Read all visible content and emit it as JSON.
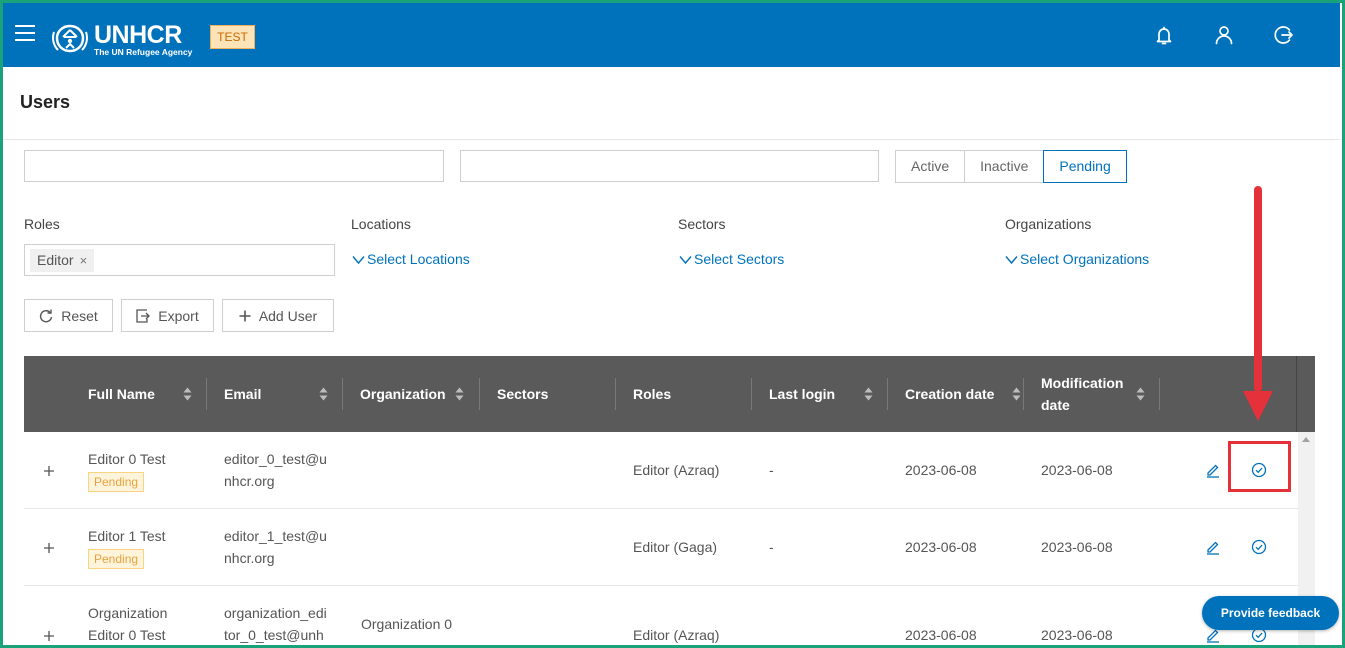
{
  "header": {
    "logo_name": "UNHCR",
    "logo_subtitle": "The UN Refugee Agency",
    "env_badge": "TEST",
    "icons": [
      "menu-icon",
      "bell-icon",
      "user-icon",
      "logout-icon"
    ]
  },
  "page": {
    "title": "Users"
  },
  "search": {
    "field1_value": "",
    "field2_value": ""
  },
  "status_tabs": {
    "items": [
      "Active",
      "Inactive",
      "Pending"
    ],
    "selected": "Pending"
  },
  "filters": {
    "roles": {
      "label": "Roles",
      "selected_tag": "Editor",
      "remove_glyph": "×"
    },
    "locations": {
      "label": "Locations",
      "placeholder": "Select Locations"
    },
    "sectors": {
      "label": "Sectors",
      "placeholder": "Select Sectors"
    },
    "organizations": {
      "label": "Organizations",
      "placeholder": "Select Organizations"
    }
  },
  "actions": {
    "reset": "Reset",
    "export": "Export",
    "add_user": "Add User"
  },
  "table": {
    "columns": [
      "Full Name",
      "Email",
      "Organization",
      "Sectors",
      "Roles",
      "Last login",
      "Creation date",
      "Modification date"
    ],
    "modification_lines": [
      "Modification",
      "date"
    ],
    "rows": [
      {
        "name": "Editor 0 Test",
        "badge": "Pending",
        "email_1": "editor_0_test@u",
        "email_2": "nhcr.org",
        "organization": "",
        "sectors": "",
        "roles": "Editor (Azraq)",
        "last_login": "-",
        "created": "2023-06-08",
        "modified": "2023-06-08"
      },
      {
        "name": "Editor 1 Test",
        "badge": "Pending",
        "email_1": "editor_1_test@u",
        "email_2": "nhcr.org",
        "organization": "",
        "sectors": "",
        "roles": "Editor (Gaga)",
        "last_login": "-",
        "created": "2023-06-08",
        "modified": "2023-06-08"
      },
      {
        "name_1": "Organization",
        "name_2": "Editor 0 Test",
        "email_1": "organization_edi",
        "email_2": "tor_0_test@unh",
        "organization": "Organization 0",
        "sectors": "",
        "roles": "Editor (Azraq)",
        "last_login": "",
        "created": "2023-06-08",
        "modified": "2023-06-08"
      }
    ]
  },
  "feedback": {
    "label": "Provide feedback"
  },
  "colors": {
    "brand": "#0072bc",
    "header_bg": "#5a5a5a",
    "pending_text": "#e8a23a",
    "annotation": "#e5313a"
  }
}
